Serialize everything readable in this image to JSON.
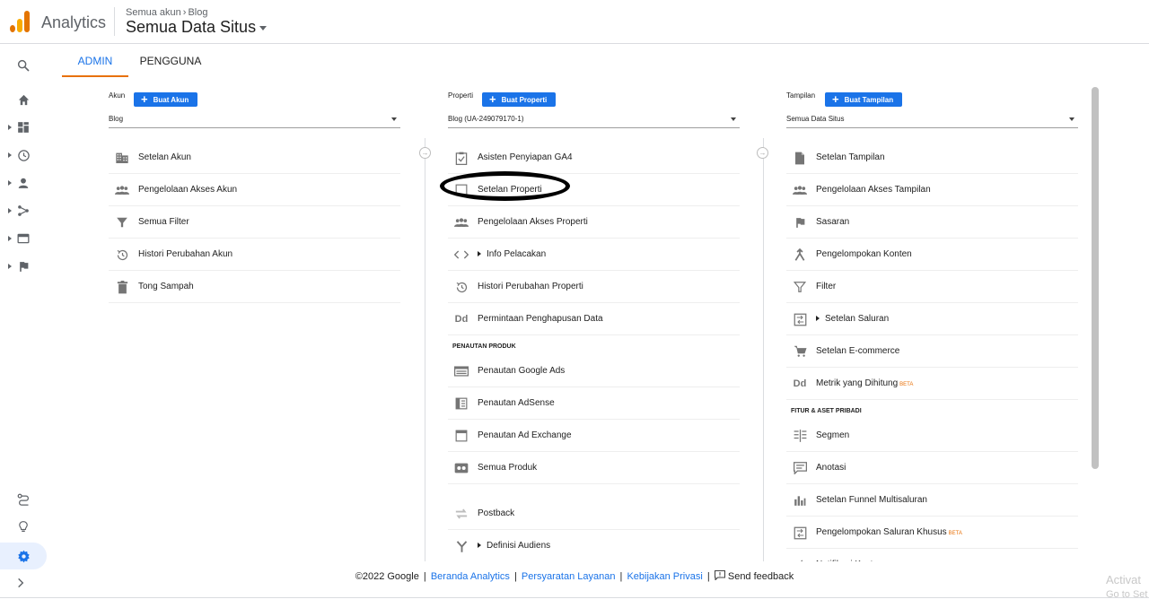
{
  "header": {
    "brand": "Analytics",
    "breadcrumb_root": "Semua akun",
    "breadcrumb_leaf": "Blog",
    "view_selector": "Semua Data Situs"
  },
  "tabs": [
    {
      "label": "ADMIN",
      "active": true
    },
    {
      "label": "PENGGUNA",
      "active": false
    }
  ],
  "columns": {
    "account": {
      "label": "Akun",
      "button": "Buat Akun",
      "selected": "Blog",
      "items": [
        {
          "icon": "building-icon",
          "label": "Setelan Akun"
        },
        {
          "icon": "people-icon",
          "label": "Pengelolaan Akses Akun"
        },
        {
          "icon": "filter-icon",
          "label": "Semua Filter"
        },
        {
          "icon": "history-icon",
          "label": "Histori Perubahan Akun"
        },
        {
          "icon": "trash-icon",
          "label": "Tong Sampah"
        }
      ]
    },
    "property": {
      "label": "Properti",
      "button": "Buat Properti",
      "selected": "Blog (UA-249079170-1)",
      "items": [
        {
          "icon": "checkbox-icon",
          "label": "Asisten Penyiapan GA4"
        },
        {
          "icon": "settings-square-icon",
          "label": "Setelan Properti"
        },
        {
          "icon": "people-icon",
          "label": "Pengelolaan Akses Properti"
        },
        {
          "icon": "code-icon",
          "label": "Info Pelacakan",
          "expandable": true
        },
        {
          "icon": "history-icon",
          "label": "Histori Perubahan Properti"
        },
        {
          "icon": "dd-icon",
          "label": "Permintaan Penghapusan Data"
        }
      ],
      "section": "PENAUTAN PRODUK",
      "link_items": [
        {
          "icon": "ads-icon",
          "label": "Penautan Google Ads"
        },
        {
          "icon": "adsense-icon",
          "label": "Penautan AdSense"
        },
        {
          "icon": "adexchange-icon",
          "label": "Penautan Ad Exchange"
        },
        {
          "icon": "products-icon",
          "label": "Semua Produk"
        }
      ],
      "extra_items": [
        {
          "icon": "postback-icon",
          "label": "Postback"
        },
        {
          "icon": "audience-icon",
          "label": "Definisi Audiens",
          "expandable": true
        }
      ]
    },
    "view": {
      "label": "Tampilan",
      "button": "Buat Tampilan",
      "selected": "Semua Data Situs",
      "items": [
        {
          "icon": "document-icon",
          "label": "Setelan Tampilan"
        },
        {
          "icon": "people-icon",
          "label": "Pengelolaan Akses Tampilan"
        },
        {
          "icon": "flag-icon",
          "label": "Sasaran"
        },
        {
          "icon": "content-group-icon",
          "label": "Pengelompokan Konten"
        },
        {
          "icon": "filter-icon",
          "label": "Filter"
        },
        {
          "icon": "channel-icon",
          "label": "Setelan Saluran",
          "expandable": true
        },
        {
          "icon": "cart-icon",
          "label": "Setelan E-commerce"
        },
        {
          "icon": "dd-icon",
          "label": "Metrik yang Dihitung",
          "beta": "BETA"
        }
      ],
      "section": "FITUR & ASET PRIBADI",
      "personal_items": [
        {
          "icon": "segment-icon",
          "label": "Segmen"
        },
        {
          "icon": "annotation-icon",
          "label": "Anotasi"
        },
        {
          "icon": "funnel-icon",
          "label": "Setelan Funnel Multisaluran"
        },
        {
          "icon": "channel-icon",
          "label": "Pengelompokan Saluran Khusus",
          "beta": "BETA"
        },
        {
          "icon": "notification-icon",
          "label": "Notifikasi Kustom"
        }
      ]
    }
  },
  "footer": {
    "copyright": "©2022 Google",
    "links": [
      "Beranda Analytics",
      "Persyaratan Layanan",
      "Kebijakan Privasi"
    ],
    "feedback": "Send feedback"
  },
  "watermark": {
    "line1": "Activat",
    "line2": "Go to Set"
  },
  "colors": {
    "accent": "#1a73e8",
    "tab_underline": "#e8710a",
    "logo": "#f9ab00"
  }
}
